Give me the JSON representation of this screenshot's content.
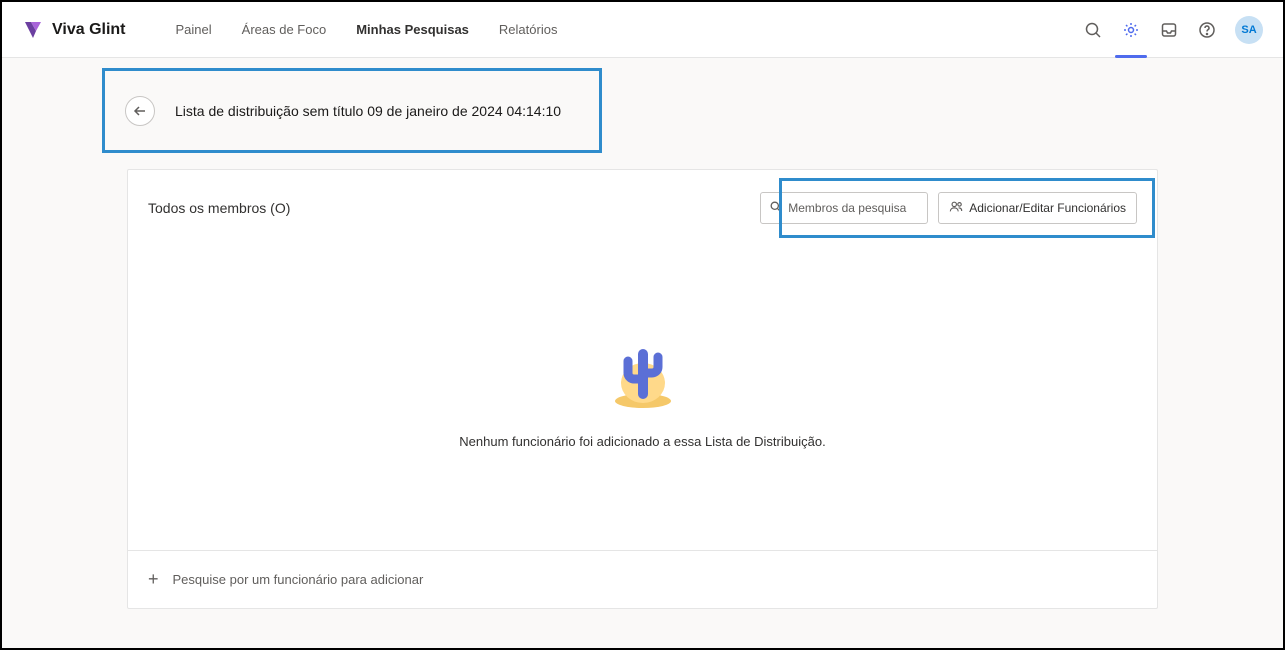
{
  "header": {
    "brand": "Viva Glint",
    "nav": {
      "painel": "Painel",
      "areas": "Áreas de Foco",
      "pesquisas": "Minhas Pesquisas",
      "relatorios": "Relatórios"
    },
    "avatar_initials": "SA"
  },
  "page": {
    "title": "Lista de distribuição sem título 09 de janeiro de 2024 04:14:10"
  },
  "card": {
    "members_label": "Todos os membros (O)",
    "search_placeholder": "Membros da pesquisa",
    "add_button": "Adicionar/Editar Funcionários",
    "empty_message": "Nenhum funcionário foi adicionado a essa Lista de Distribuição.",
    "footer_search": "Pesquise por um funcionário para adicionar"
  }
}
